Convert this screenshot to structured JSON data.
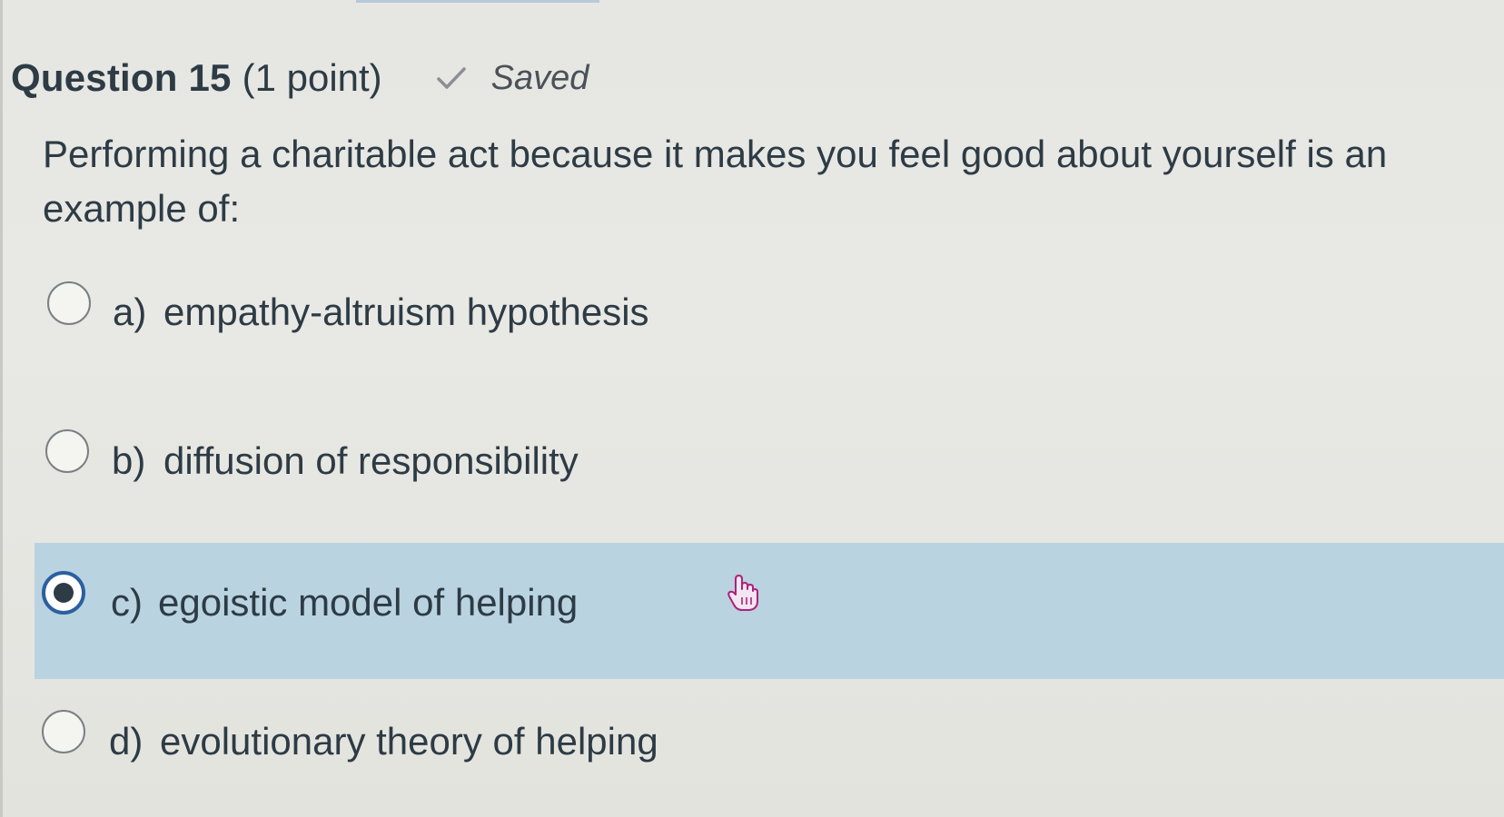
{
  "question": {
    "title": "Question 15",
    "points": "(1 point)",
    "status": "Saved",
    "prompt": "Performing a charitable act because it makes you feel good about yourself is an example of:"
  },
  "options": [
    {
      "letter": "a)",
      "text": "empathy-altruism hypothesis",
      "selected": false
    },
    {
      "letter": "b)",
      "text": "diffusion of responsibility",
      "selected": false
    },
    {
      "letter": "c)",
      "text": "egoistic model of helping",
      "selected": true
    },
    {
      "letter": "d)",
      "text": "evolutionary theory of helping",
      "selected": false
    }
  ],
  "colors": {
    "selected_background": "#b9d3e0",
    "radio_checked_border": "#2b5fa0",
    "text": "#2d3b45"
  },
  "icons": {
    "status": "checkmark-icon",
    "cursor": "hand-pointer-icon"
  }
}
